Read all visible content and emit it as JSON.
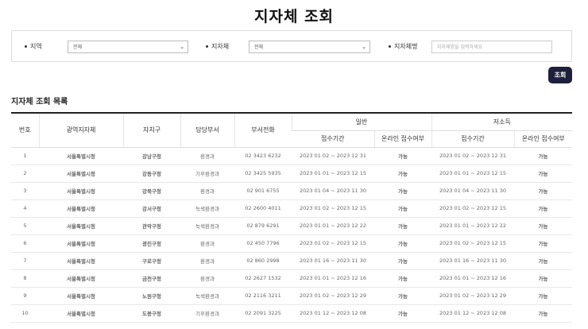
{
  "page": {
    "title": "지자체 조회"
  },
  "filters": {
    "region": {
      "label": "지역",
      "value": "전체"
    },
    "municipality": {
      "label": "지자체",
      "value": "전체"
    },
    "name": {
      "label": "지자체명",
      "placeholder": "지자체명을 입력하세요"
    }
  },
  "search_button": "조회",
  "section": {
    "title": "지자체 조회 목록"
  },
  "table": {
    "headers": {
      "no": "번호",
      "metro": "광역지자체",
      "district": "자치구",
      "dept": "담당부서",
      "phone": "부서전화",
      "group_general": "일반",
      "group_low_income": "저소득",
      "period": "접수기간",
      "online": "온라인 접수여부"
    },
    "rows": [
      {
        "no": "1",
        "metro": "서울특별시청",
        "district": "강남구청",
        "dept": "환경과",
        "phone": "02 3423 6232",
        "gen_period": "2023 01 02 ~ 2023 12 31",
        "gen_online": "가능",
        "low_period": "2023 01 02 ~ 2023 12 31",
        "low_online": "가능"
      },
      {
        "no": "2",
        "metro": "서울특별시청",
        "district": "강동구청",
        "dept": "기후환경과",
        "phone": "02 3425 5935",
        "gen_period": "2023 01 01 ~ 2023 12 15",
        "gen_online": "가능",
        "low_period": "2023 01 01 ~ 2023 12 15",
        "low_online": "가능"
      },
      {
        "no": "3",
        "metro": "서울특별시청",
        "district": "강북구청",
        "dept": "환경과",
        "phone": "02 901 6755",
        "gen_period": "2023 01 04 ~ 2023 11 30",
        "gen_online": "가능",
        "low_period": "2023 01 04 ~ 2023 11 30",
        "low_online": "가능"
      },
      {
        "no": "4",
        "metro": "서울특별시청",
        "district": "강서구청",
        "dept": "녹색환경과",
        "phone": "02 2600 4011",
        "gen_period": "2023 01 02 ~ 2023 12 15",
        "gen_online": "가능",
        "low_period": "2023 01 02 ~ 2023 12 15",
        "low_online": "가능"
      },
      {
        "no": "5",
        "metro": "서울특별시청",
        "district": "관악구청",
        "dept": "녹색환경과",
        "phone": "02 879 6291",
        "gen_period": "2023 01 01 ~ 2023 12 22",
        "gen_online": "가능",
        "low_period": "2023 01 01 ~ 2023 12 22",
        "low_online": "가능"
      },
      {
        "no": "6",
        "metro": "서울특별시청",
        "district": "광진구청",
        "dept": "환경과",
        "phone": "02 450 7796",
        "gen_period": "2023 01 02 ~ 2023 12 15",
        "gen_online": "가능",
        "low_period": "2023 01 02 ~ 2023 12 15",
        "low_online": "가능"
      },
      {
        "no": "7",
        "metro": "서울특별시청",
        "district": "구로구청",
        "dept": "환경과",
        "phone": "02 860 2998",
        "gen_period": "2023 01 16 ~ 2023 11 30",
        "gen_online": "가능",
        "low_period": "2023 01 16 ~ 2023 11 30",
        "low_online": "가능"
      },
      {
        "no": "8",
        "metro": "서울특별시청",
        "district": "금천구청",
        "dept": "환경과",
        "phone": "02 2627 1532",
        "gen_period": "2023 01 01 ~ 2023 12 16",
        "gen_online": "가능",
        "low_period": "2023 01 01 ~ 2023 12 16",
        "low_online": "가능"
      },
      {
        "no": "9",
        "metro": "서울특별시청",
        "district": "노원구청",
        "dept": "녹색환경과",
        "phone": "02 2116 3211",
        "gen_period": "2023 01 02 ~ 2023 12 29",
        "gen_online": "가능",
        "low_period": "2023 01 02 ~ 2023 12 29",
        "low_online": "가능"
      },
      {
        "no": "10",
        "metro": "서울특별시청",
        "district": "도봉구청",
        "dept": "기후환경과",
        "phone": "02 2091 3225",
        "gen_period": "2023 01 12 ~ 2023 12 08",
        "gen_online": "가능",
        "low_period": "2023 01 12 ~ 2023 12 08",
        "low_online": "가능"
      }
    ]
  }
}
